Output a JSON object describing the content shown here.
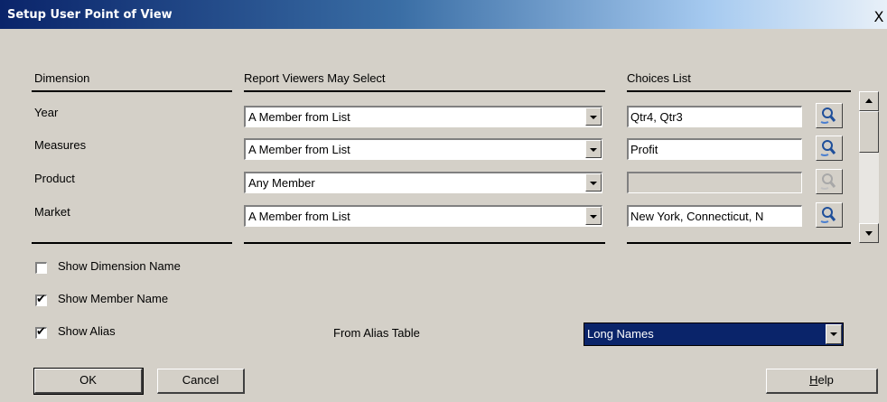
{
  "window": {
    "title": "Setup User Point of View",
    "close_glyph": "X"
  },
  "headers": {
    "dimension": "Dimension",
    "viewers": "Report Viewers May Select",
    "choices": "Choices List"
  },
  "rows": [
    {
      "dimension": "Year",
      "select": "A Member from List",
      "choices": "Qtr4, Qtr3",
      "picker_enabled": true
    },
    {
      "dimension": "Measures",
      "select": "A Member from List",
      "choices": "Profit",
      "picker_enabled": true
    },
    {
      "dimension": "Product",
      "select": "Any Member",
      "choices": "",
      "picker_enabled": false
    },
    {
      "dimension": "Market",
      "select": "A Member from List",
      "choices": "New York, Connecticut, N",
      "picker_enabled": true
    }
  ],
  "options": {
    "show_dimension_name": {
      "label": "Show Dimension Name",
      "checked": false
    },
    "show_member_name": {
      "label": "Show Member Name",
      "checked": true
    },
    "show_alias": {
      "label": "Show Alias",
      "checked": true
    }
  },
  "alias": {
    "from_label": "From Alias Table",
    "value": "Long Names"
  },
  "buttons": {
    "ok": "OK",
    "cancel": "Cancel",
    "help_mnemonic": "H",
    "help_rest": "elp"
  },
  "icons": {
    "picker": "member-picker-icon",
    "check_glyph": "✔"
  }
}
